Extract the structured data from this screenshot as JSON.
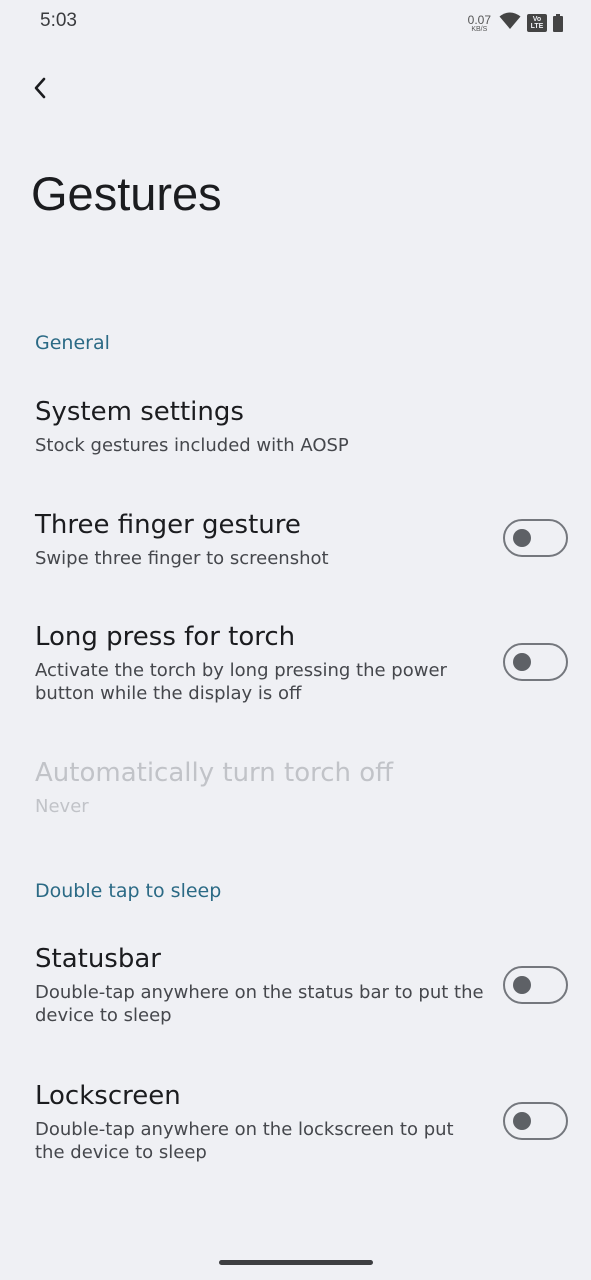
{
  "status_bar": {
    "time": "5:03",
    "net_speed_value": "0.07",
    "net_speed_unit": "KB/S",
    "volte_top": "Vo",
    "volte_bottom": "LTE",
    "icons": [
      "wifi-icon",
      "volte-icon",
      "battery-icon"
    ]
  },
  "header": {
    "back_icon": "back-arrow-icon",
    "title": "Gestures"
  },
  "sections": [
    {
      "header": "General",
      "items": [
        {
          "title": "System settings",
          "summary": "Stock gestures included with AOSP",
          "has_switch": false
        },
        {
          "title": "Three finger gesture",
          "summary": "Swipe three finger to screenshot",
          "has_switch": true,
          "switch_on": false
        },
        {
          "title": "Long press for torch",
          "summary": "Activate the torch by long pressing the power button while the display is off",
          "has_switch": true,
          "switch_on": false
        },
        {
          "title": "Automatically turn torch off",
          "summary": "Never",
          "has_switch": false,
          "disabled": true
        }
      ]
    },
    {
      "header": "Double tap to sleep",
      "items": [
        {
          "title": "Statusbar",
          "summary": "Double-tap anywhere on the status bar to put the device to sleep",
          "has_switch": true,
          "switch_on": false
        },
        {
          "title": "Lockscreen",
          "summary": "Double-tap anywhere on the lockscreen to put the device to sleep",
          "has_switch": true,
          "switch_on": false
        }
      ]
    }
  ],
  "colors": {
    "background": "#eff0f4",
    "accent": "#2b6a85",
    "text_primary": "#1b1c1f",
    "text_secondary": "#45474c",
    "text_disabled": "#c1c3c8"
  }
}
